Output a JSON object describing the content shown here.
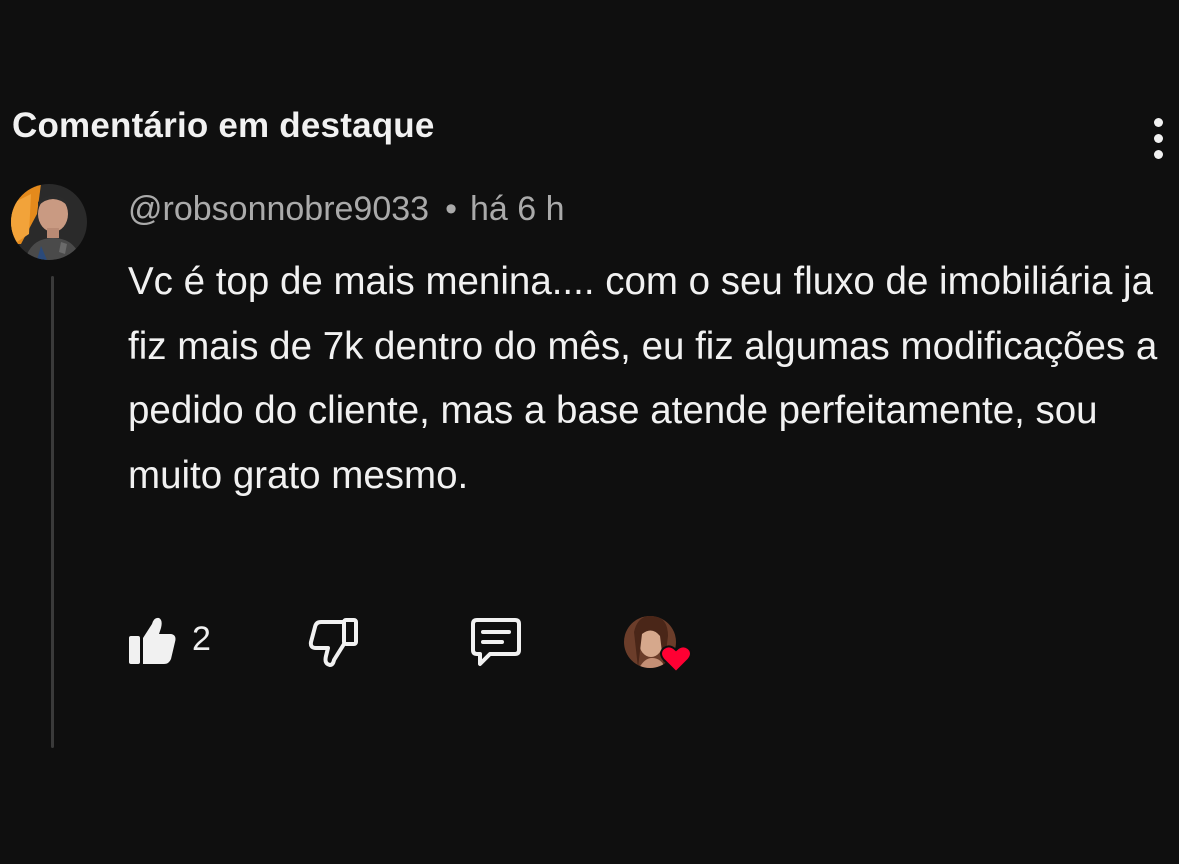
{
  "section": {
    "title": "Comentário em destaque",
    "menu_icon": "more-vert-icon"
  },
  "comment": {
    "author": "@robsonnobre9033",
    "separator": "•",
    "time": "há 6 h",
    "text": "Vc é top de mais menina.... com o seu fluxo de imobiliária ja fiz mais de 7k dentro do mês, eu fiz algumas modificações a pedido do cliente, mas a base atende perfeitamente, sou muito grato mesmo.",
    "avatar_icon": "user-avatar"
  },
  "actions": {
    "like_icon": "thumbs-up-icon",
    "like_count": "2",
    "dislike_icon": "thumbs-down-icon",
    "reply_icon": "comment-icon",
    "creator_heart_icon": "creator-heart-icon"
  },
  "colors": {
    "background": "#0f0f0f",
    "text_primary": "#f1f1f1",
    "text_secondary": "#aaaaaa",
    "heart": "#ff0033"
  }
}
